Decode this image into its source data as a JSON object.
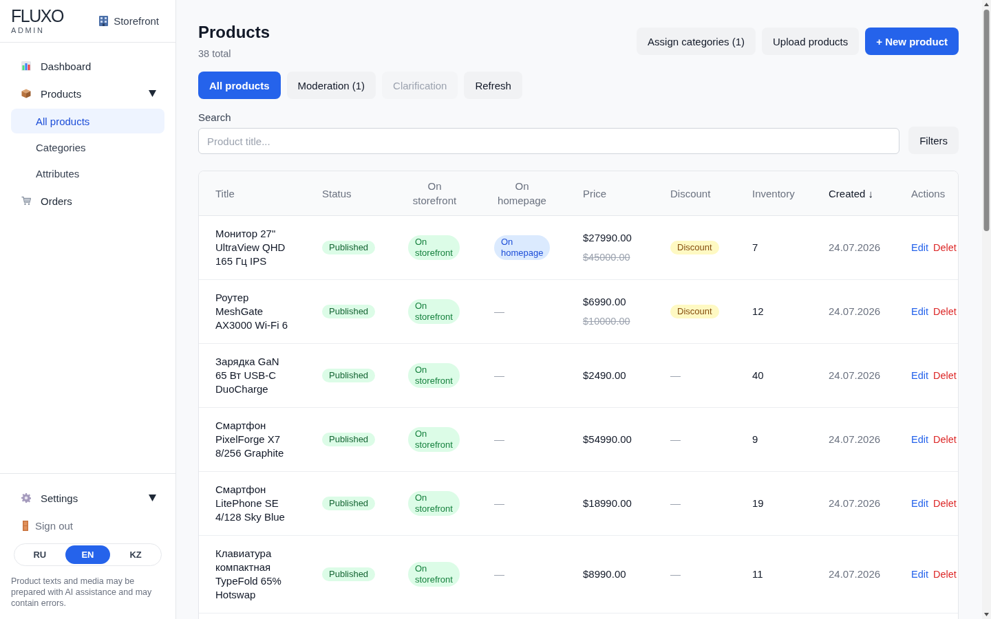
{
  "sidebar": {
    "logo": {
      "wordmark": "FLUXO",
      "subtitle": "ADMIN"
    },
    "storefront_link": "Storefront",
    "nav": [
      {
        "label": "Dashboard",
        "kind": "link"
      },
      {
        "label": "Products",
        "kind": "group",
        "children": [
          {
            "label": "All products",
            "selected": true
          },
          {
            "label": "Categories",
            "selected": false
          },
          {
            "label": "Attributes",
            "selected": false
          }
        ]
      },
      {
        "label": "Orders",
        "kind": "link"
      }
    ],
    "settings": {
      "label": "Settings"
    },
    "sign_out": {
      "label": "Sign out"
    },
    "languages": [
      {
        "label": "RU",
        "selected": false
      },
      {
        "label": "EN",
        "selected": true
      },
      {
        "label": "KZ",
        "selected": false
      }
    ],
    "disclaimer": "Product texts and media may be prepared with AI assistance and may contain errors."
  },
  "header": {
    "title": "Products",
    "subtitle": "38 total",
    "actions": [
      {
        "label": "Assign categories (1)",
        "kind": "secondary"
      },
      {
        "label": "Upload products",
        "kind": "secondary"
      },
      {
        "label": "+ New product",
        "kind": "primary"
      }
    ]
  },
  "tabs": [
    {
      "label": "All products",
      "selected": true,
      "disabled": false
    },
    {
      "label": "Moderation (1)",
      "selected": false,
      "disabled": false
    },
    {
      "label": "Clarification",
      "selected": false,
      "disabled": true
    }
  ],
  "refresh_button": "Refresh",
  "search": {
    "label": "Search",
    "placeholder": "Product title...",
    "filters_button": "Filters"
  },
  "table": {
    "columns": [
      {
        "label": "Title",
        "kind": "text",
        "sorted": false
      },
      {
        "label": "Status",
        "kind": "text",
        "sorted": false
      },
      {
        "label": "On storefront",
        "kind": "flag",
        "sorted": false
      },
      {
        "label": "On homepage",
        "kind": "flag",
        "sorted": false
      },
      {
        "label": "Price",
        "kind": "text",
        "sorted": false
      },
      {
        "label": "Discount",
        "kind": "text",
        "sorted": false
      },
      {
        "label": "Inventory",
        "kind": "text",
        "sorted": false
      },
      {
        "label": "Created ↓",
        "kind": "text",
        "sorted": true
      },
      {
        "label": "Actions",
        "kind": "text",
        "sorted": false
      }
    ],
    "rows": [
      {
        "title": "Монитор 27\" UltraView QHD 165 Гц IPS",
        "status": "Published",
        "storefront": "On storefront",
        "on_homepage": true,
        "homepage": "On homepage",
        "price": "$27990.00",
        "discounted": true,
        "old_price": "$45000.00",
        "discount": "Discount",
        "inventory": "7",
        "created": "24.07.2026",
        "actions": [
          {
            "label": "Edit",
            "kind": "edit"
          },
          {
            "label": "Delet",
            "kind": "delete"
          }
        ]
      },
      {
        "title": "Роутер MeshGate AX3000 Wi-Fi 6",
        "status": "Published",
        "storefront": "On storefront",
        "on_homepage": false,
        "homepage": "—",
        "price": "$6990.00",
        "discounted": true,
        "old_price": "$10000.00",
        "discount": "Discount",
        "inventory": "12",
        "created": "24.07.2026",
        "actions": [
          {
            "label": "Edit",
            "kind": "edit"
          },
          {
            "label": "Delet",
            "kind": "delete"
          }
        ]
      },
      {
        "title": "Зарядка GaN 65 Вт USB-C DuoCharge",
        "status": "Published",
        "storefront": "On storefront",
        "on_homepage": false,
        "homepage": "—",
        "price": "$2490.00",
        "discounted": false,
        "discount": "—",
        "inventory": "40",
        "created": "24.07.2026",
        "actions": [
          {
            "label": "Edit",
            "kind": "edit"
          },
          {
            "label": "Delet",
            "kind": "delete"
          }
        ]
      },
      {
        "title": "Смартфон PixelForge X7 8/256 Graphite",
        "status": "Published",
        "storefront": "On storefront",
        "on_homepage": false,
        "homepage": "—",
        "price": "$54990.00",
        "discounted": false,
        "discount": "—",
        "inventory": "9",
        "created": "24.07.2026",
        "actions": [
          {
            "label": "Edit",
            "kind": "edit"
          },
          {
            "label": "Delet",
            "kind": "delete"
          }
        ]
      },
      {
        "title": "Смартфон LitePhone SE 4/128 Sky Blue",
        "status": "Published",
        "storefront": "On storefront",
        "on_homepage": false,
        "homepage": "—",
        "price": "$18990.00",
        "discounted": false,
        "discount": "—",
        "inventory": "19",
        "created": "24.07.2026",
        "actions": [
          {
            "label": "Edit",
            "kind": "edit"
          },
          {
            "label": "Delet",
            "kind": "delete"
          }
        ]
      },
      {
        "title": "Клавиатура компактная TypeFold 65% Hotswap",
        "status": "Published",
        "storefront": "On storefront",
        "on_homepage": false,
        "homepage": "—",
        "price": "$8990.00",
        "discounted": false,
        "discount": "—",
        "inventory": "11",
        "created": "24.07.2026",
        "actions": [
          {
            "label": "Edit",
            "kind": "edit"
          },
          {
            "label": "Delet",
            "kind": "delete"
          }
        ]
      }
    ]
  }
}
